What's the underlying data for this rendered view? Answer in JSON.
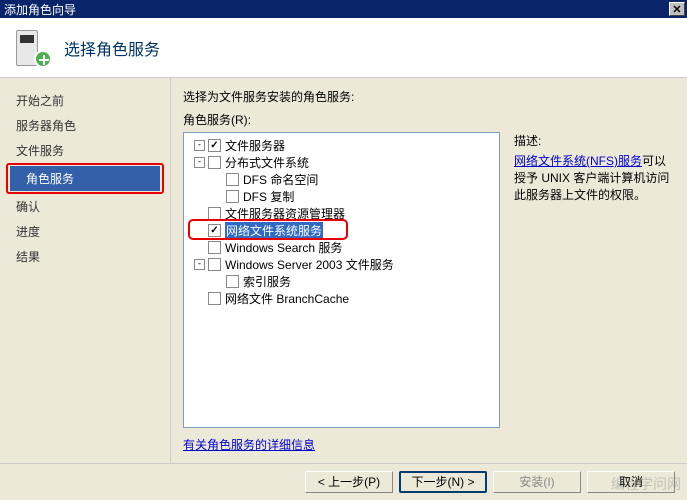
{
  "window": {
    "title": "添加角色向导"
  },
  "header": {
    "title": "选择角色服务"
  },
  "sidebar": {
    "items": [
      {
        "label": "开始之前",
        "active": false
      },
      {
        "label": "服务器角色",
        "active": false
      },
      {
        "label": "文件服务",
        "active": false
      },
      {
        "label": "角色服务",
        "active": true,
        "highlighted": true
      },
      {
        "label": "确认",
        "active": false
      },
      {
        "label": "进度",
        "active": false
      },
      {
        "label": "结果",
        "active": false
      }
    ]
  },
  "main": {
    "instructions": "选择为文件服务安装的角色服务:",
    "roles_label": "角色服务(R):",
    "more_info_link": "有关角色服务的详细信息"
  },
  "tree": [
    {
      "indent": 0,
      "expander": "-",
      "checked": true,
      "label": "文件服务器"
    },
    {
      "indent": 0,
      "expander": "-",
      "checked": false,
      "label": "分布式文件系统"
    },
    {
      "indent": 1,
      "expander": "",
      "checked": false,
      "label": "DFS 命名空间"
    },
    {
      "indent": 1,
      "expander": "",
      "checked": false,
      "label": "DFS 复制"
    },
    {
      "indent": 0,
      "expander": "",
      "checked": false,
      "label": "文件服务器资源管理器"
    },
    {
      "indent": 0,
      "expander": "",
      "checked": true,
      "label": "网络文件系统服务",
      "selected": true,
      "row_highlight": true
    },
    {
      "indent": 0,
      "expander": "",
      "checked": false,
      "label": "Windows Search 服务"
    },
    {
      "indent": 0,
      "expander": "-",
      "checked": false,
      "label": "Windows Server 2003 文件服务"
    },
    {
      "indent": 1,
      "expander": "",
      "checked": false,
      "label": "索引服务"
    },
    {
      "indent": 0,
      "expander": "",
      "checked": false,
      "label": "网络文件 BranchCache"
    }
  ],
  "description": {
    "title": "描述:",
    "link_text": "网络文件系统(NFS)服务",
    "body": "可以授予 UNIX 客户端计算机访问此服务器上文件的权限。"
  },
  "footer": {
    "back": "< 上一步(P)",
    "next": "下一步(N) >",
    "install": "安装(I)",
    "cancel": "取消"
  },
  "watermark": "编程学问网"
}
